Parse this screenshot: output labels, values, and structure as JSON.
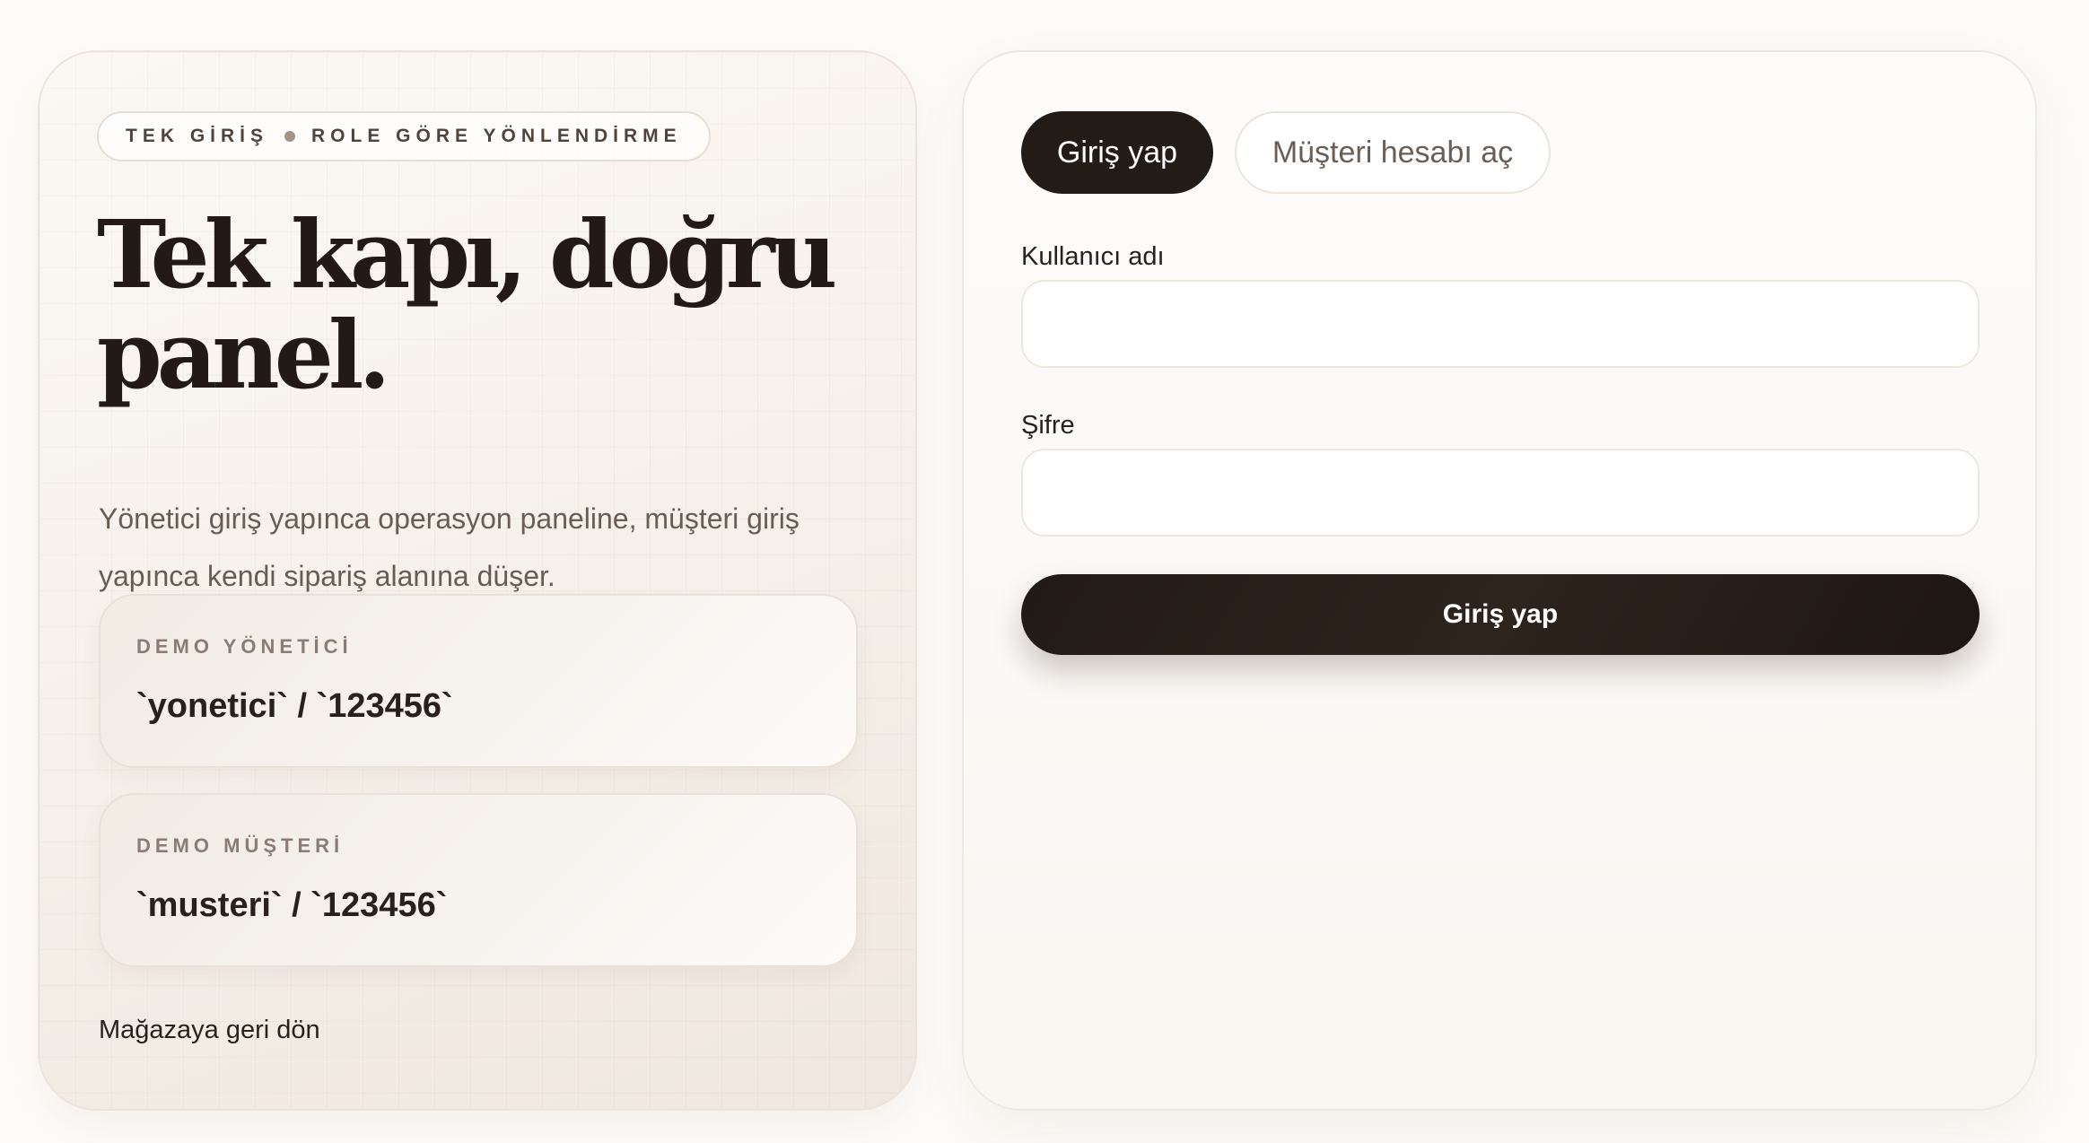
{
  "hero": {
    "eyebrow_left": "TEK GİRİŞ",
    "eyebrow_right": "ROLE GÖRE YÖNLENDİRME",
    "title_line1": "Tek kapı, doğru",
    "title_line2": "panel.",
    "description": "Yönetici giriş yapınca operasyon paneline, müşteri giriş yapınca kendi sipariş alanına düşer.",
    "demo_admin": {
      "label": "DEMO YÖNETİCİ",
      "credentials": "`yonetici` / `123456`"
    },
    "demo_customer": {
      "label": "DEMO MÜŞTERİ",
      "credentials": "`musteri` / `123456`"
    },
    "back_link": "Mağazaya geri dön"
  },
  "form": {
    "tabs": [
      {
        "label": "Giriş yap",
        "active": true
      },
      {
        "label": "Müşteri hesabı aç",
        "active": false
      }
    ],
    "username_label": "Kullanıcı adı",
    "username_value": "",
    "password_label": "Şifre",
    "password_value": "",
    "submit_label": "Giriş yap"
  },
  "colors": {
    "accent_dark": "#231b16",
    "page_background": "#fdfbf8",
    "muted_text": "#695c53"
  }
}
